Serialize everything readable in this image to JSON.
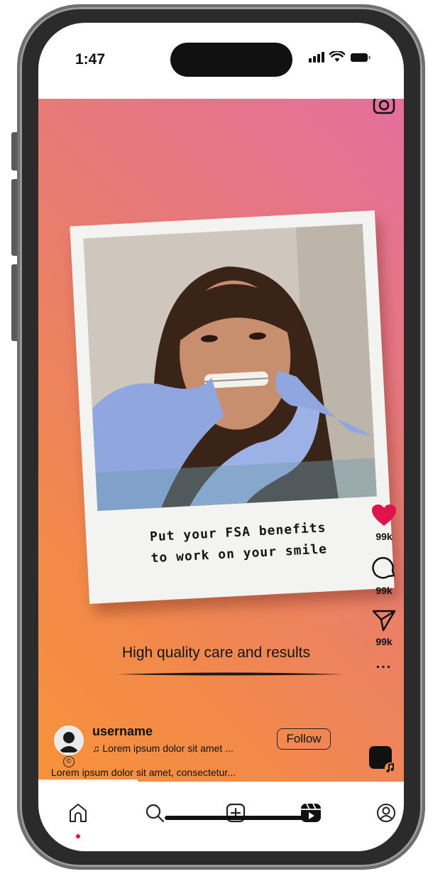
{
  "status_bar": {
    "time": "1:47"
  },
  "post": {
    "image_caption_line1": "Put your FSA benefits",
    "image_caption_line2": "to work on your smile",
    "tagline": "High quality care and results",
    "username": "username",
    "audio": "Lorem ipsum dolor sit amet ...",
    "follow_label": "Follow",
    "description": "Lorem ipsum dolor sit amet, consectetur..."
  },
  "actions": {
    "likes": "99k",
    "comments": "99k",
    "shares": "99k",
    "more": "..."
  },
  "colors": {
    "like_red": "#e0144c",
    "gradient_top": "#e46f9c",
    "gradient_bottom": "#f7923b"
  },
  "nav": [
    "home-icon",
    "search-icon",
    "create-icon",
    "reels-icon",
    "profile-icon"
  ]
}
